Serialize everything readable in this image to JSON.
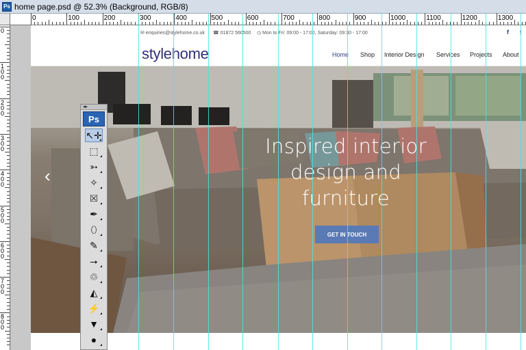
{
  "window": {
    "app_icon_label": "Ps",
    "document_title": "home page.psd @ 52.3% (Background, RGB/8)"
  },
  "rulers": {
    "horizontal_labels": [
      "0",
      "100",
      "200",
      "300",
      "400",
      "500",
      "600",
      "700",
      "800",
      "900",
      "1000",
      "1100",
      "1200",
      "1300"
    ],
    "vertical_labels": [
      "0",
      "100",
      "200",
      "300",
      "400",
      "500",
      "600",
      "700",
      "800"
    ]
  },
  "toolbox": {
    "title_label": "Ps",
    "grip_label": "◂▸",
    "tools": [
      {
        "name": "move-tool",
        "glyph": "↖✛"
      },
      {
        "name": "marquee-tool",
        "glyph": "⬚"
      },
      {
        "name": "lasso-tool",
        "glyph": "➳"
      },
      {
        "name": "magic-wand-tool",
        "glyph": "✧"
      },
      {
        "name": "crop-tool",
        "glyph": "⮽"
      },
      {
        "name": "eyedropper-tool",
        "glyph": "✒"
      },
      {
        "name": "healing-brush-tool",
        "glyph": "⬯"
      },
      {
        "name": "brush-tool",
        "glyph": "✎"
      },
      {
        "name": "clone-stamp-tool",
        "glyph": "⭢"
      },
      {
        "name": "history-brush-tool",
        "glyph": "♲"
      },
      {
        "name": "eraser-tool",
        "glyph": "◭"
      },
      {
        "name": "paint-bucket-tool",
        "glyph": "⚡"
      },
      {
        "name": "blur-tool",
        "glyph": "▼"
      },
      {
        "name": "dodge-tool",
        "glyph": "●"
      }
    ]
  },
  "website": {
    "topbar": {
      "email": "✉ enquiries@stylehome.co.uk",
      "phone": "☎ 01872 560500",
      "hours": "◷ Mon to Fri: 09:00 - 17:00, Saturday: 09:30 - 17:00",
      "facebook": "f",
      "twitter": "t"
    },
    "logo": "stylehome",
    "nav": [
      "Home",
      "Shop",
      "Interior Design",
      "Services",
      "Projects",
      "About"
    ],
    "hero": {
      "headline_line1": "Inspired interior",
      "headline_line2": "design and",
      "headline_line3": "furniture",
      "cta": "GET IN TOUCH",
      "prev_arrow": "‹"
    },
    "colors": {
      "logo": "#2f2f7a",
      "cta_bg": "#5a7ab5",
      "guide": "#3fe8e8"
    }
  }
}
